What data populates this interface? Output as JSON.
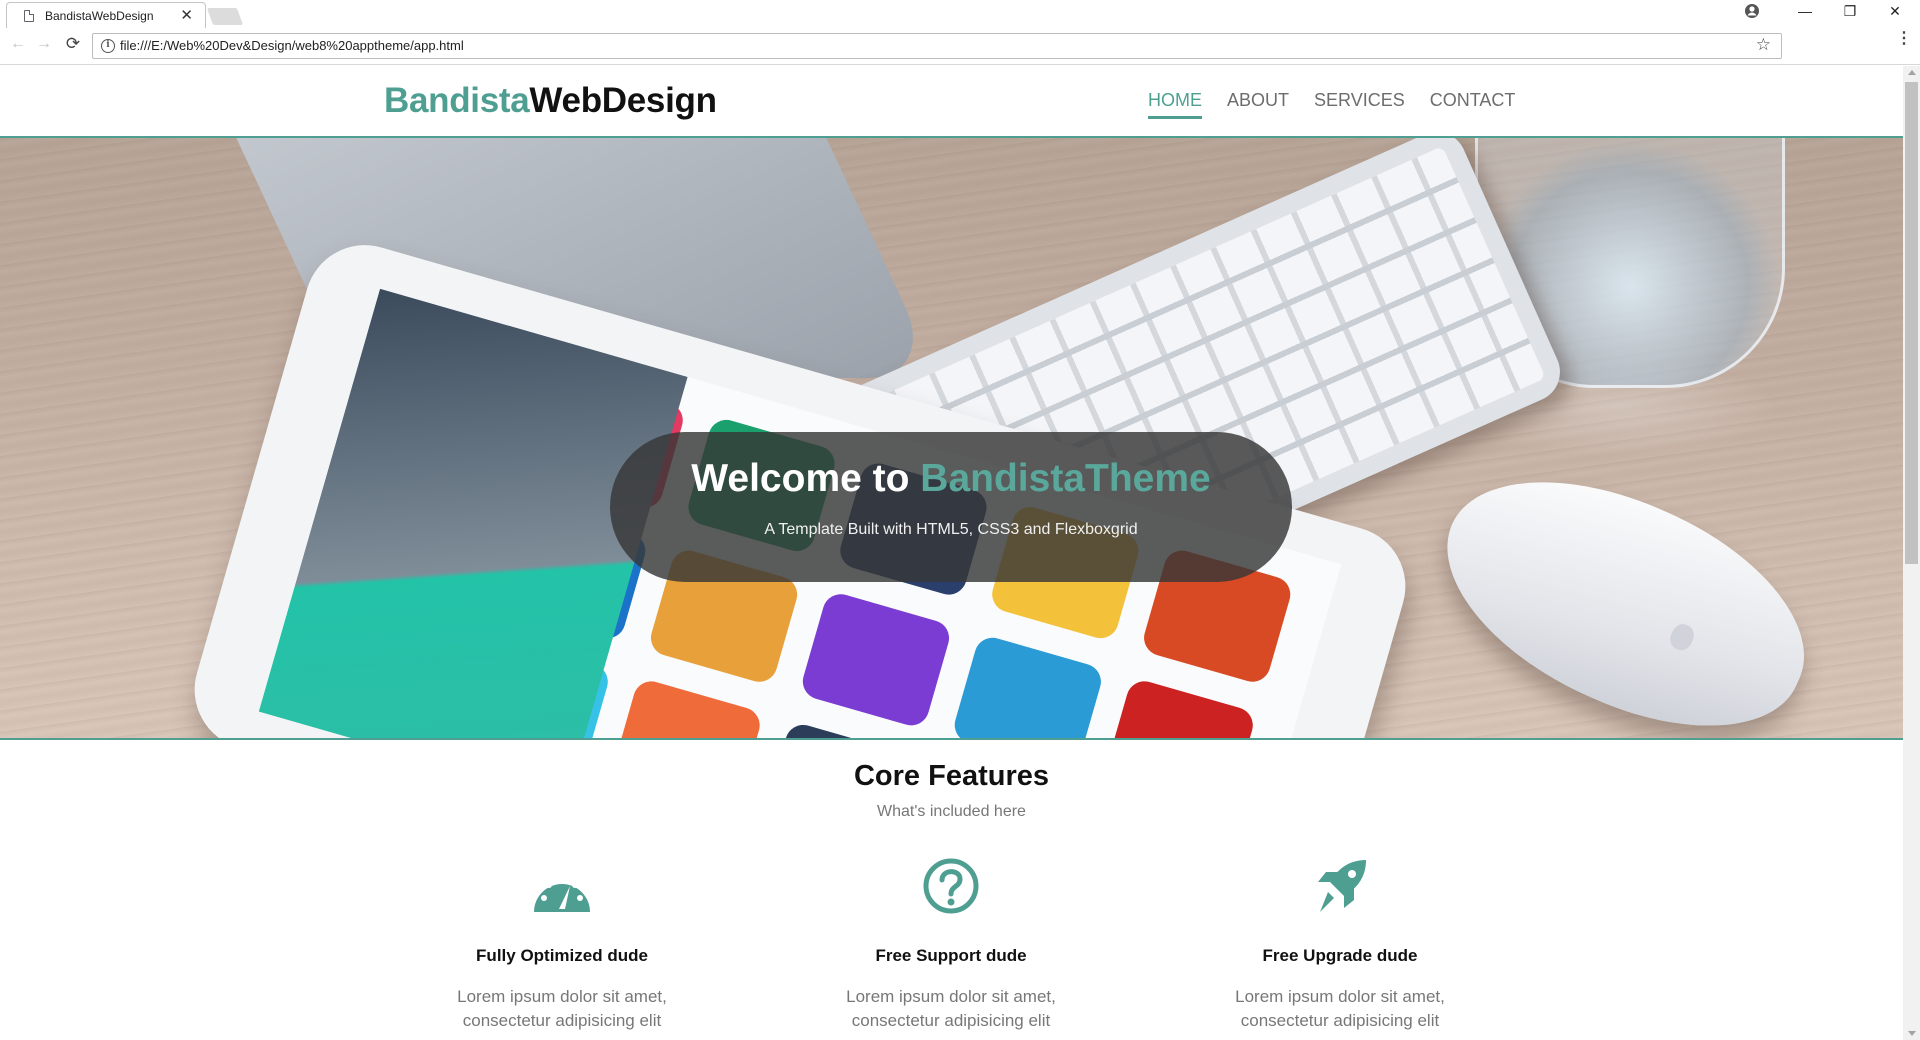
{
  "browser": {
    "tab_title": "BandistaWebDesign",
    "tab_close": "✕",
    "url": "file:///E:/Web%20Dev&Design/web8%20apptheme/app.html",
    "info_glyph": "i",
    "star_glyph": "☆",
    "window_controls": {
      "minimize": "—",
      "restore": "❐",
      "close": "✕"
    },
    "nav": {
      "back": "←",
      "forward": "→",
      "reload": "⟳"
    },
    "menu_glyph": "⋮",
    "icons": [
      "page-icon",
      "profile-icon",
      "info-icon",
      "star-icon",
      "back-arrow-icon",
      "forward-arrow-icon",
      "reload-icon",
      "menu-icon"
    ]
  },
  "site": {
    "logo_accent": "Bandista",
    "logo_rest": "WebDesign",
    "nav": [
      {
        "label": "HOME",
        "active": true
      },
      {
        "label": "ABOUT",
        "active": false
      },
      {
        "label": "SERVICES",
        "active": false
      },
      {
        "label": "CONTACT",
        "active": false
      }
    ],
    "accent_color": "#4e9f92"
  },
  "hero": {
    "title_prefix": "Welcome to ",
    "title_accent": "BandistaTheme",
    "subtitle": "A Template Built with HTML5, CSS3 and Flexboxgrid"
  },
  "features": {
    "title": "Core Features",
    "subtitle": "What's included here",
    "items": [
      {
        "icon": "dashboard-icon",
        "title": "Fully Optimized dude",
        "text": "Lorem ipsum dolor sit amet, consectetur adipisicing elit"
      },
      {
        "icon": "question-circle-icon",
        "title": "Free Support dude",
        "text": "Lorem ipsum dolor sit amet, consectetur adipisicing elit"
      },
      {
        "icon": "rocket-icon",
        "title": "Free Upgrade dude",
        "text": "Lorem ipsum dolor sit amet, consectetur adipisicing elit"
      }
    ]
  }
}
